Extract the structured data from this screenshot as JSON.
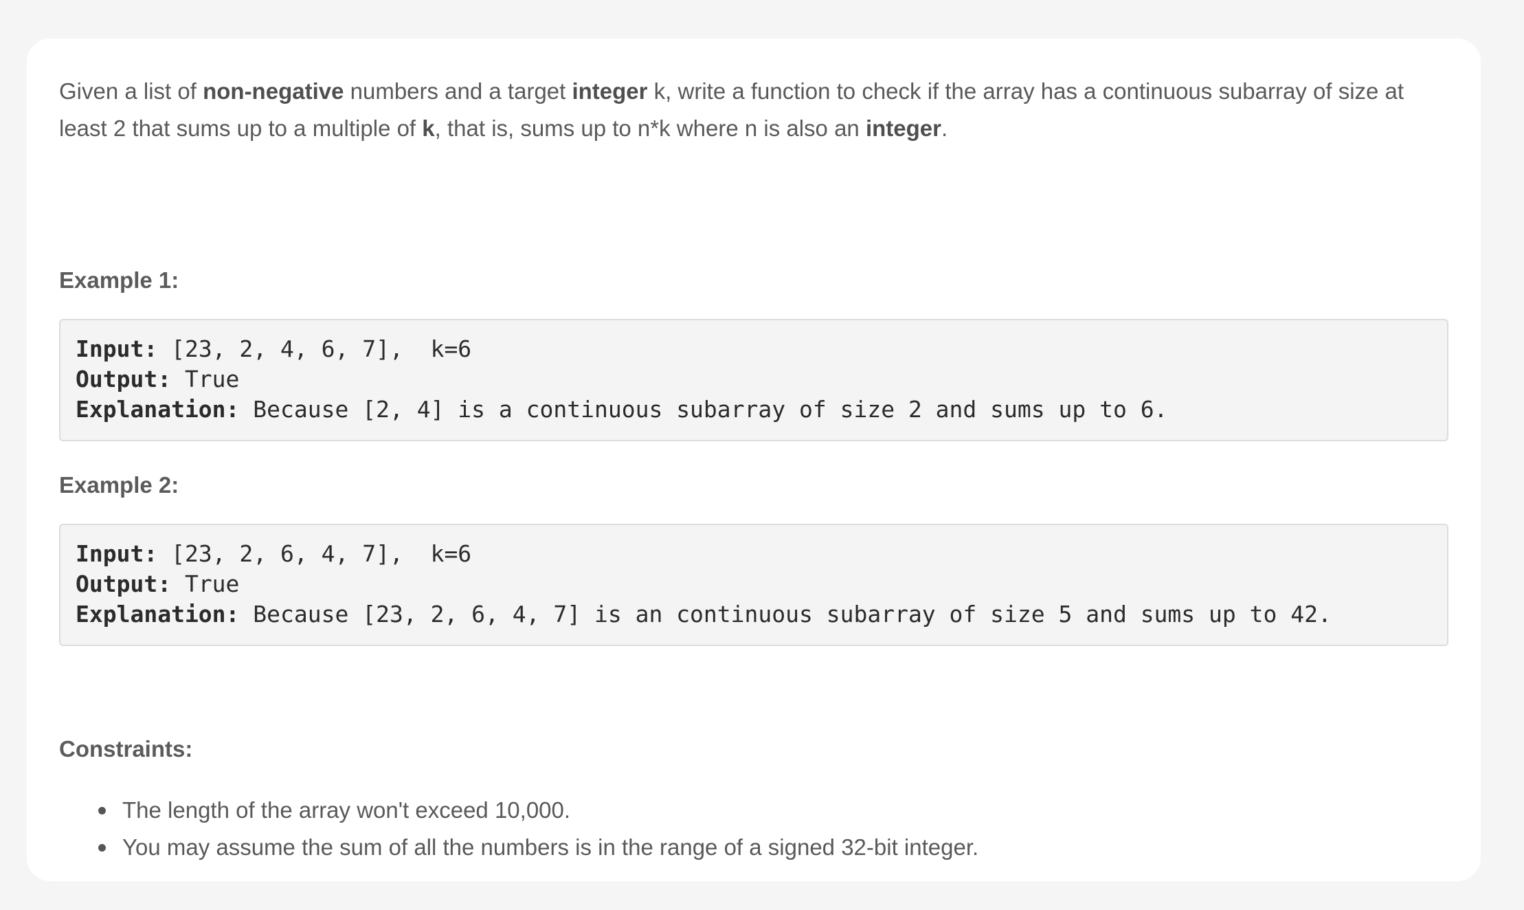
{
  "problem": {
    "intro": {
      "t1": "Given a list of ",
      "b1": "non-negative",
      "t2": " numbers and a target ",
      "b2": "integer",
      "t3": " k, write a function to check if the array has a continuous subarray of size at least 2 that sums up to a multiple of ",
      "b3": "k",
      "t4": ", that is, sums up to n*k where n is also an ",
      "b4": "integer",
      "t5": "."
    },
    "examples": [
      {
        "heading": "Example 1:",
        "input_label": "Input:",
        "input_value": " [23, 2, 4, 6, 7],  k=6",
        "output_label": "Output:",
        "output_value": " True",
        "explanation_label": "Explanation:",
        "explanation_value": " Because [2, 4] is a continuous subarray of size 2 and sums up to 6."
      },
      {
        "heading": "Example 2:",
        "input_label": "Input:",
        "input_value": " [23, 2, 6, 4, 7],  k=6",
        "output_label": "Output:",
        "output_value": " True",
        "explanation_label": "Explanation:",
        "explanation_value": " Because [23, 2, 6, 4, 7] is an continuous subarray of size 5 and sums up to 42."
      }
    ],
    "constraints": {
      "heading": "Constraints:",
      "items": [
        "The length of the array won't exceed 10,000.",
        "You may assume the sum of all the numbers is in the range of a signed 32-bit integer."
      ]
    }
  },
  "colors": {
    "page_background": "#f5f5f5",
    "card_background": "#ffffff",
    "code_background": "#f4f4f4",
    "text": "#595959"
  }
}
